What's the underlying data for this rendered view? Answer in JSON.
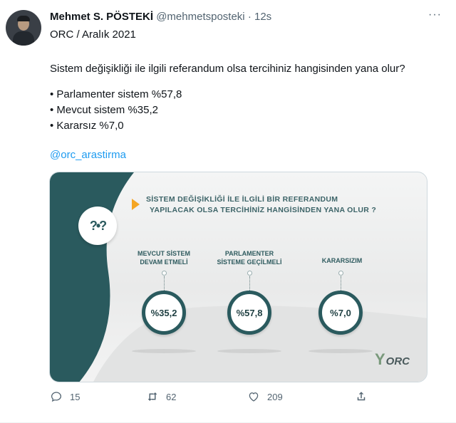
{
  "tweet": {
    "author_name": "Mehmet S. PÖSTEKİ",
    "handle": "@mehmetsposteki",
    "separator": "·",
    "time": "12s",
    "more_label": "···",
    "line1": "ORC / Aralık 2021",
    "line2": "Sistem değişikliği ile ilgili referandum olsa tercihiniz hangisinden yana olur?",
    "bullets": [
      "• Parlamenter sistem %57,8",
      "• Mevcut sistem %35,2",
      "• Kararsız %7,0"
    ],
    "mention": "@orc_arastirma"
  },
  "card": {
    "question_line1": "SİSTEM DEĞİŞİKLİĞİ İLE İLGİLİ BİR REFERANDUM",
    "question_line2": "YAPILACAK  OLSA TERCİHİNİZ HANGİSİNDEN YANA OLUR ?",
    "options": [
      {
        "label_line1": "MEVCUT SİSTEM",
        "label_line2": "DEVAM ETMELİ",
        "value": "%35,2"
      },
      {
        "label_line1": "PARLAMENTER",
        "label_line2": "SİSTEME GEÇİLMELİ",
        "value": "%57,8"
      },
      {
        "label_line1": "KARARSIZIM",
        "label_line2": "",
        "value": "%7,0"
      }
    ],
    "logo_text": "ORC",
    "logo_mark": "Y",
    "question_icon": "?•?",
    "accent_color": "#2a5a5e",
    "arrow_color": "#f5a623"
  },
  "actions": {
    "reply_count": "15",
    "retweet_count": "62",
    "like_count": "209"
  }
}
